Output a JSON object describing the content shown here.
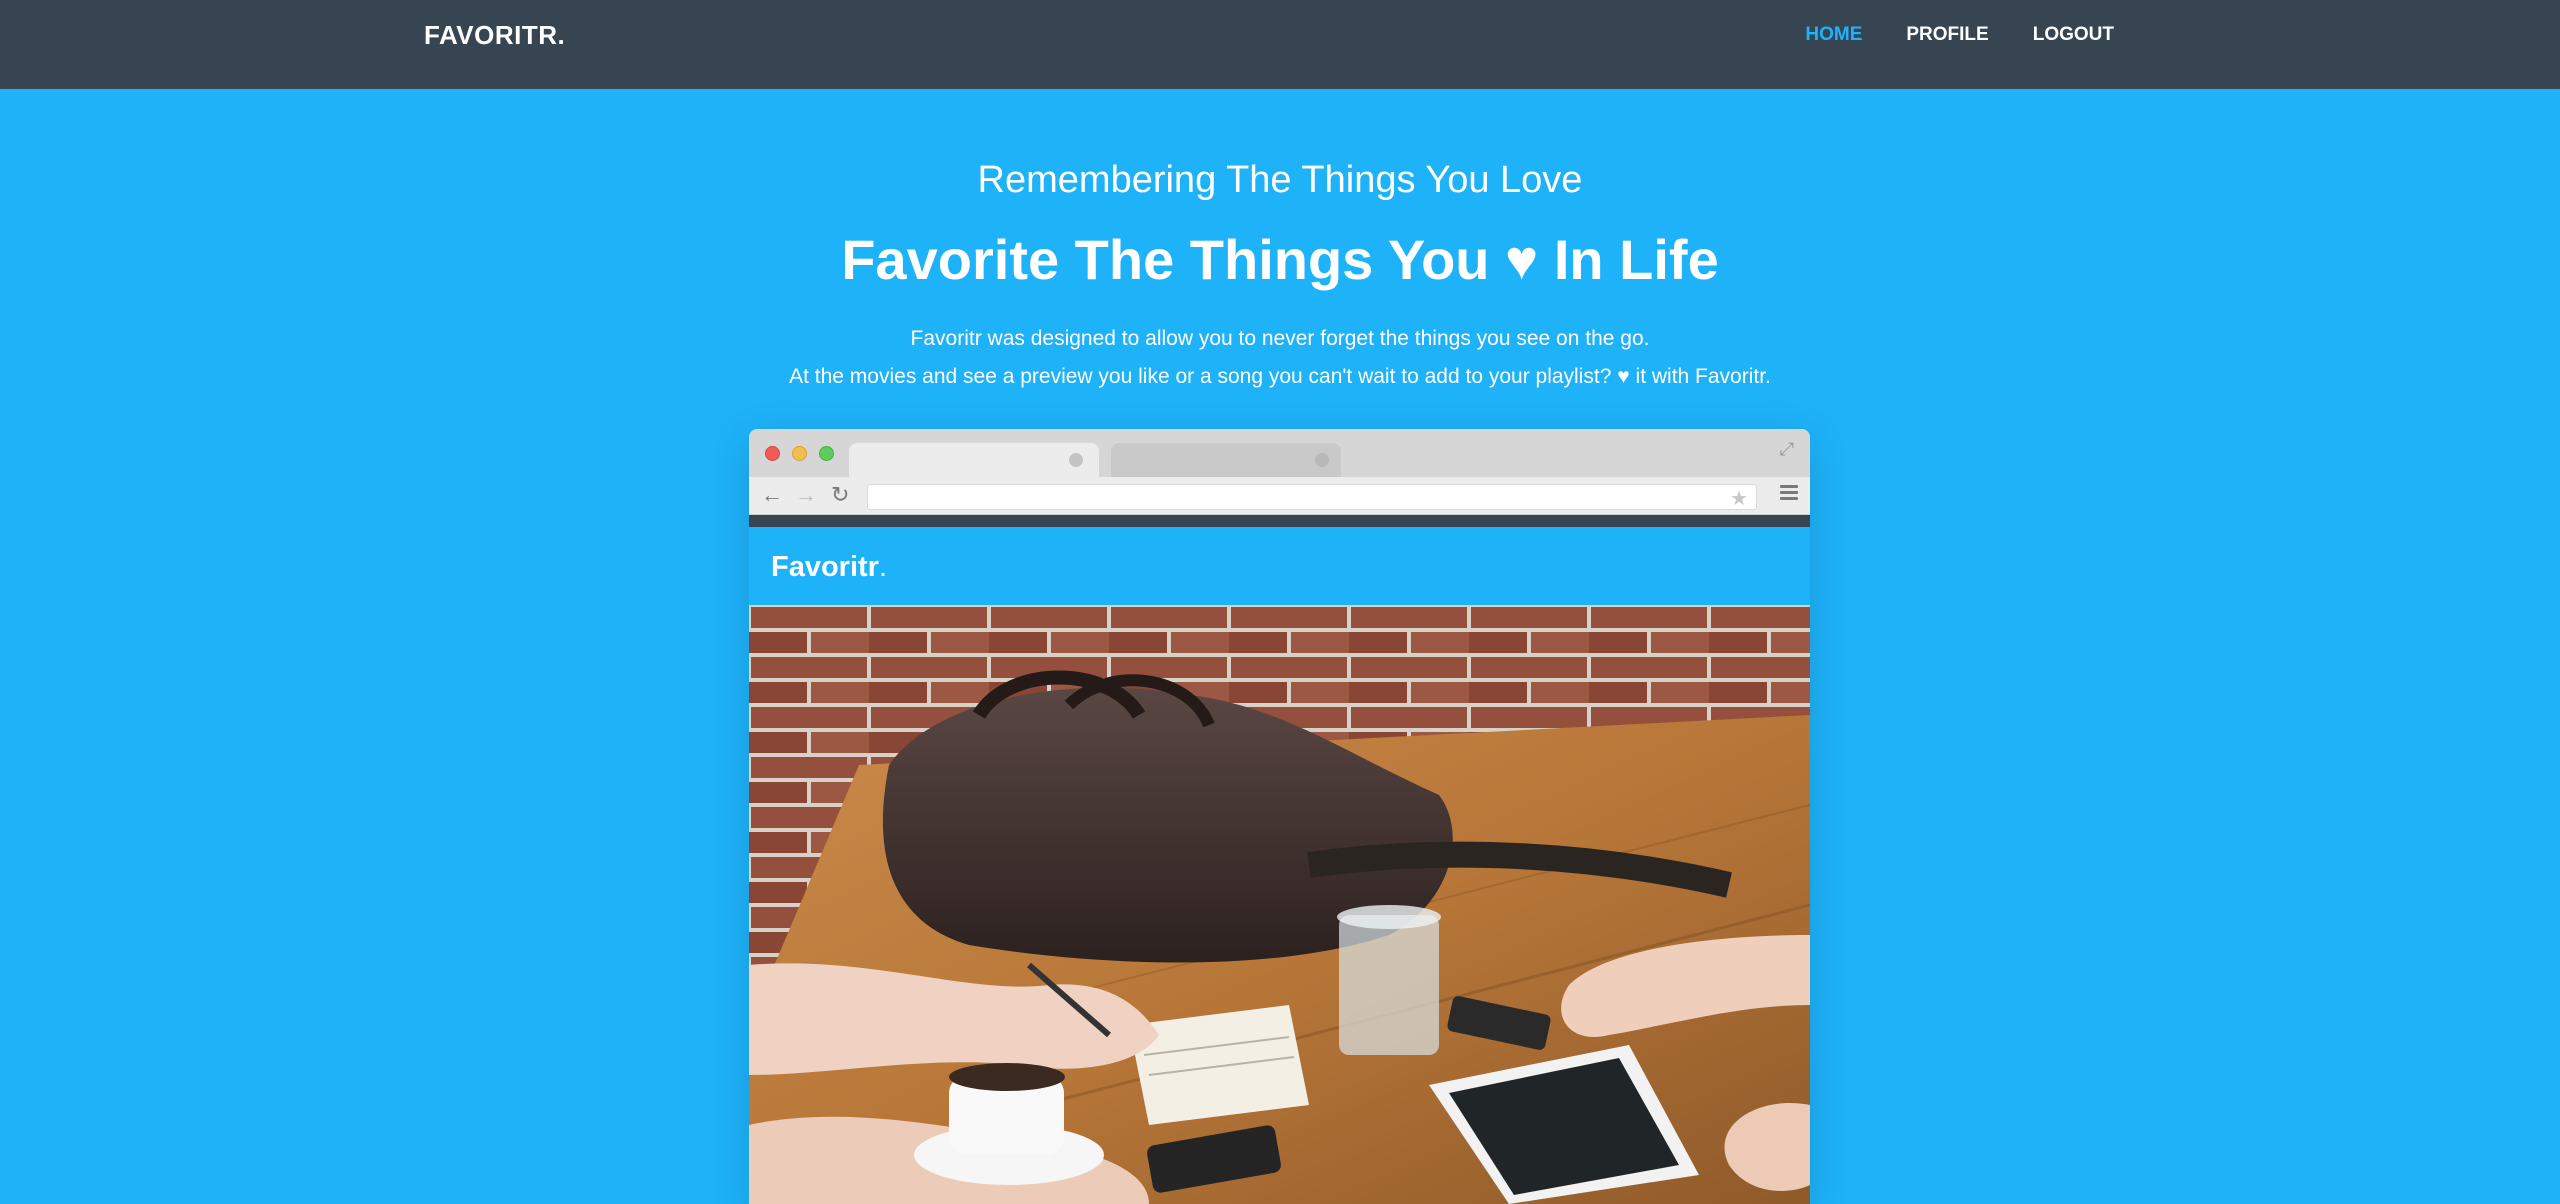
{
  "nav": {
    "brand": "FAVORITR.",
    "links": [
      {
        "label": "HOME",
        "active": true
      },
      {
        "label": "PROFILE",
        "active": false
      },
      {
        "label": "LOGOUT",
        "active": false
      }
    ]
  },
  "hero": {
    "subtitle": "Remembering The Things You Love",
    "title": "Favorite The Things You ♥ In Life",
    "desc_line1": "Favoritr was designed to allow you to never forget the things you see on the go.",
    "desc_line2": "At the movies and see a preview you like or a song you can't wait to add to your playlist? ♥ it with Favoritr."
  },
  "mockup": {
    "brand": "Favoritr",
    "brand_dot": ".",
    "icons": {
      "back": "arrow-left-icon",
      "forward": "arrow-right-icon",
      "reload": "reload-icon",
      "star": "star-icon",
      "menu": "menu-icon",
      "expand": "expand-icon"
    }
  },
  "colors": {
    "accent": "#1eb2f9",
    "nav_bg": "#374553",
    "text": "#ffffff"
  }
}
